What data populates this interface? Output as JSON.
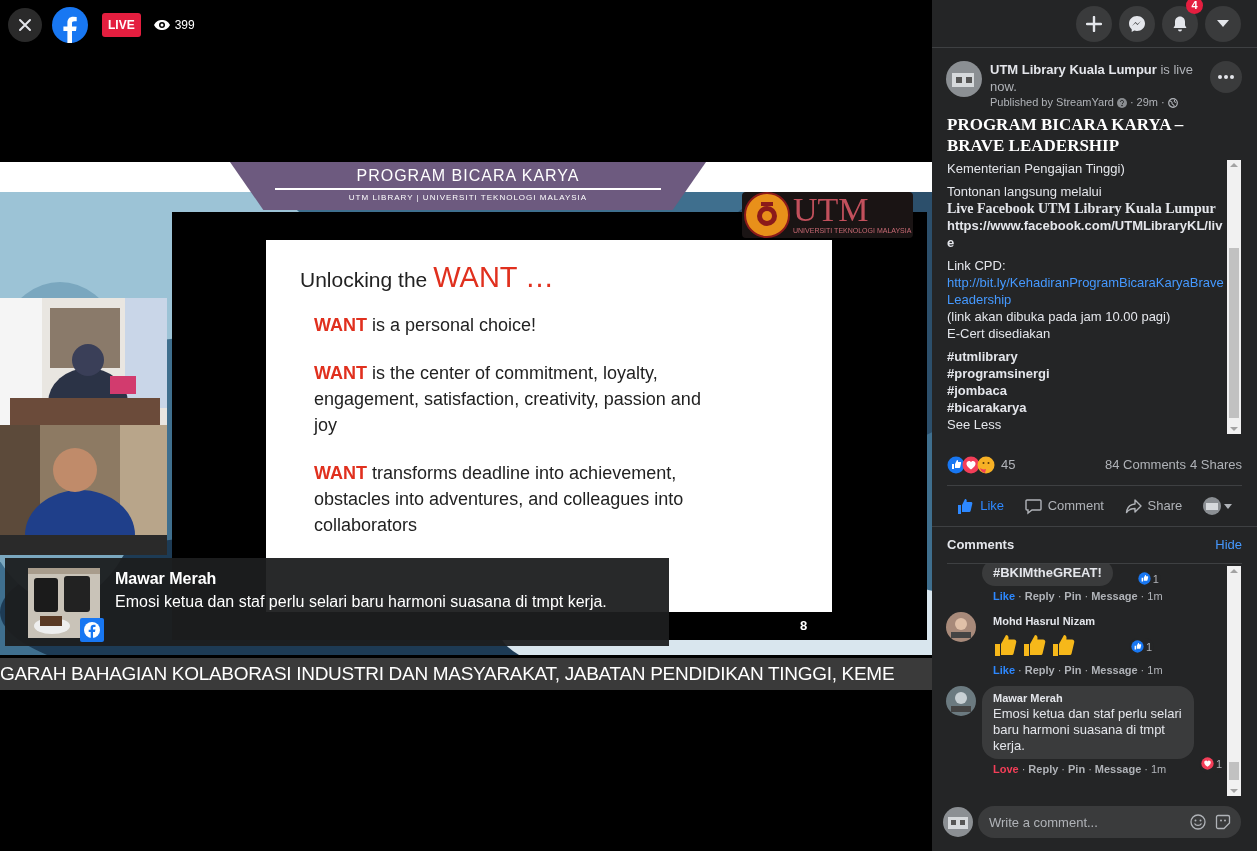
{
  "top_bar": {
    "live_badge": "LIVE",
    "viewers": "399"
  },
  "video": {
    "banner": {
      "title": "PROGRAM BICARA KARYA",
      "subtitle": "UTM LIBRARY | UNIVERSITI TEKNOLOGI MALAYSIA"
    },
    "logo": {
      "name": "UTM",
      "subtitle": "UNIVERSITI TEKNOLOGI MALAYSIA"
    },
    "slide": {
      "title": "Unlocking the",
      "title_emphasis": "WANT …",
      "points": [
        {
          "keyword": "WANT",
          "text": "is a personal choice!"
        },
        {
          "keyword": "WANT",
          "text": "is the center of commitment, loyalty, engagement, satisfaction, creativity, passion and joy"
        },
        {
          "keyword": "WANT",
          "text": "transforms deadline into achievement, obstacles into adventures, and colleagues into collaborators"
        }
      ],
      "page": "8"
    },
    "overlay_comment": {
      "author": "Mawar Merah",
      "text": "Emosi ketua dan staf perlu selari baru harmoni suasana di tmpt kerja."
    },
    "ticker": "GARAH BAHAGIAN KOLABORASI INDUSTRI DAN MASYARAKAT, JABATAN PENDIDIKAN TINGGI, KEME"
  },
  "header_buttons": [
    {
      "kind": "plus"
    },
    {
      "kind": "messenger"
    },
    {
      "kind": "bell",
      "badge": "4"
    },
    {
      "kind": "caret"
    }
  ],
  "post": {
    "author": "UTM Library Kuala Lumpur",
    "status": "is live now.",
    "meta": [
      {
        "kind": "text",
        "text": "Published by StreamYard"
      },
      {
        "kind": "info"
      },
      {
        "kind": "separator",
        "text": "·"
      },
      {
        "kind": "time",
        "text": "29m"
      },
      {
        "kind": "separator",
        "text": "·"
      },
      {
        "kind": "globe"
      }
    ],
    "title": "PROGRAM BICARA KARYA – BRAVE LEADERSHIP",
    "description": [
      [
        {
          "kind": "text",
          "text": "Kementerian Pengajian Tinggi)"
        }
      ],
      [
        {
          "kind": "text",
          "text": "Tontonan langsung melalui"
        },
        {
          "kind": "serif",
          "text": "Live Facebook UTM Library Kuala Lumpur"
        },
        {
          "kind": "url",
          "text": "https://www.facebook.com/UTMLibraryKL/live"
        }
      ],
      [
        {
          "kind": "text",
          "text": "Link CPD:"
        },
        {
          "kind": "link",
          "text": "http://bit.ly/KehadiranProgramBicaraKaryaBraveLeadership"
        },
        {
          "kind": "text",
          "text": "(link akan dibuka pada jam 10.00 pagi)"
        },
        {
          "kind": "text",
          "text": "E-Cert disediakan"
        }
      ],
      [
        {
          "kind": "hashtag",
          "text": "#utmlibrary"
        },
        {
          "kind": "hashtag",
          "text": "#programsinergi"
        },
        {
          "kind": "hashtag",
          "text": "#jombaca"
        },
        {
          "kind": "hashtag",
          "text": "#bicarakarya"
        },
        {
          "kind": "text",
          "text": "See Less"
        }
      ]
    ],
    "reaction_count": "45",
    "comments": "84 Comments",
    "shares": "4 Shares",
    "actions": [
      {
        "kind": "like",
        "label": "Like",
        "selected": true
      },
      {
        "kind": "comment",
        "label": "Comment",
        "selected": false
      },
      {
        "kind": "share",
        "label": "Share",
        "selected": false
      }
    ]
  },
  "comments_section": {
    "title": "Comments",
    "hide": "Hide",
    "comments": [
      {
        "body": "#BKIMtheGREAT!",
        "reaction": {
          "kind": "like",
          "count": "1"
        },
        "links": [
          {
            "kind": "like",
            "text": "Like"
          },
          {
            "kind": "separator",
            "text": "·"
          },
          {
            "kind": "action",
            "text": "Reply"
          },
          {
            "kind": "separator",
            "text": "·"
          },
          {
            "kind": "action",
            "text": "Pin"
          },
          {
            "kind": "separator",
            "text": "·"
          },
          {
            "kind": "action",
            "text": "Message"
          },
          {
            "kind": "separator",
            "text": "·"
          },
          {
            "kind": "time",
            "text": "1m"
          }
        ]
      },
      {
        "author": "Mohd Hasrul Nizam",
        "stickers": [
          {
            "kind": "thumbs-up"
          },
          {
            "kind": "thumbs-up"
          },
          {
            "kind": "thumbs-up"
          }
        ],
        "reaction": {
          "kind": "like",
          "count": "1"
        },
        "links": [
          {
            "kind": "like",
            "text": "Like"
          },
          {
            "kind": "separator",
            "text": "·"
          },
          {
            "kind": "action",
            "text": "Reply"
          },
          {
            "kind": "separator",
            "text": "·"
          },
          {
            "kind": "action",
            "text": "Pin"
          },
          {
            "kind": "separator",
            "text": "·"
          },
          {
            "kind": "action",
            "text": "Message"
          },
          {
            "kind": "separator",
            "text": "·"
          },
          {
            "kind": "time",
            "text": "1m"
          }
        ]
      },
      {
        "author": "Mawar Merah",
        "body": "Emosi ketua dan staf perlu selari baru harmoni suasana di tmpt kerja.",
        "reaction": {
          "kind": "love",
          "count": "1"
        },
        "links": [
          {
            "kind": "love",
            "text": "Love"
          },
          {
            "kind": "separator",
            "text": "·"
          },
          {
            "kind": "action",
            "text": "Reply"
          },
          {
            "kind": "separator",
            "text": "·"
          },
          {
            "kind": "action",
            "text": "Pin"
          },
          {
            "kind": "separator",
            "text": "·"
          },
          {
            "kind": "action",
            "text": "Message"
          },
          {
            "kind": "separator",
            "text": "·"
          },
          {
            "kind": "time",
            "text": "1m"
          }
        ]
      }
    ],
    "composer": {
      "placeholder": "Write a comment..."
    }
  }
}
